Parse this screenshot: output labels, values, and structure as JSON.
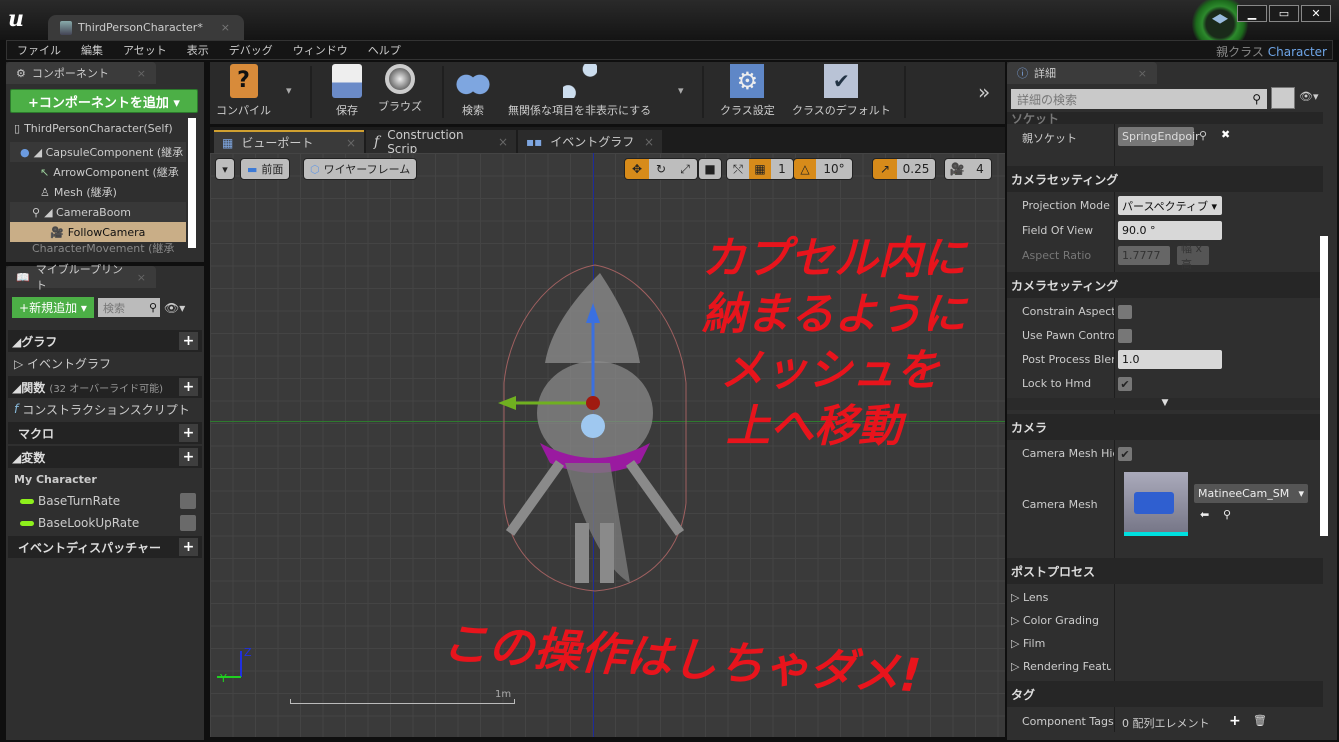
{
  "window": {
    "doc_tab": "ThirdPersonCharacter*",
    "parent_class_label": "親クラス",
    "parent_class_value": "Character",
    "minimize": "▁",
    "maximize": "▭",
    "close": "✕"
  },
  "menu": [
    "ファイル",
    "編集",
    "アセット",
    "表示",
    "デバッグ",
    "ウィンドウ",
    "ヘルプ"
  ],
  "components": {
    "tab": "コンポーネント",
    "add_button": "+コンポーネントを追加 ▾",
    "tree": [
      {
        "label": "ThirdPersonCharacter(Self)",
        "icon": "character-icon"
      },
      {
        "label": "◢ CapsuleComponent (継承",
        "icon": "capsule-icon"
      },
      {
        "label": "ArrowComponent (継承",
        "icon": "arrow-icon"
      },
      {
        "label": "Mesh (継承)",
        "icon": "mesh-icon"
      },
      {
        "label": "◢ CameraBoom",
        "icon": "spring-arm-icon"
      },
      {
        "label": "FollowCamera",
        "icon": "camera-icon"
      },
      {
        "label": "CharacterMovement (継承",
        "icon": "movement-icon"
      }
    ]
  },
  "my_blueprint": {
    "tab": "マイブループリント",
    "new_button": "+新規追加 ▾",
    "search_placeholder": "検索",
    "sections": [
      {
        "title": "◢グラフ",
        "items": [
          "▷ イベントグラフ"
        ]
      },
      {
        "title": "◢関数",
        "subtitle": "(32 オーバーライド可能)",
        "items": [
          "コンストラクションスクリプト"
        ]
      },
      {
        "title": "マクロ",
        "items": []
      },
      {
        "title": "◢変数",
        "items": []
      },
      {
        "title": "イベントディスパッチャー",
        "items": []
      }
    ],
    "var_category": "My Character",
    "variables": [
      "BaseTurnRate",
      "BaseLookUpRate"
    ]
  },
  "toolbar": {
    "compile": "コンパイル",
    "save": "保存",
    "browse": "ブラウズ",
    "find": "検索",
    "hide_unrelated": "無関係な項目を非表示にする",
    "class_settings": "クラス設定",
    "class_defaults": "クラスのデフォルト",
    "more": "»"
  },
  "editor_tabs": [
    "ビューポート",
    "Construction Scrip",
    "イベントグラフ"
  ],
  "viewport": {
    "view_mode_dropdown": "▾",
    "view_front": "前面",
    "view_wireframe": "ワイヤーフレーム",
    "grid_snap": "1",
    "rotation_snap": "10°",
    "scale_snap": "0.25",
    "camera_speed": "4",
    "scale_label": "1m",
    "axis_z": "Z",
    "axis_y": "Y",
    "annotation_1": [
      "カプセル内に",
      "納まるように",
      "メッシュを",
      "上へ移動"
    ],
    "annotation_2": "この操作はしちゃダメ!"
  },
  "details": {
    "tab": "詳細",
    "search_placeholder": "詳細の検索",
    "sections": {
      "socket_header": "ソケット",
      "camera_settings": "カメラセッティング",
      "camera": "カメラ",
      "post_process": "ポストプロセス",
      "tags": "タグ"
    },
    "parent_socket_label": "親ソケット",
    "parent_socket_value": "SpringEndpoir",
    "projection_mode_label": "Projection Mode",
    "projection_mode_value": "パースペクティブ ▾",
    "fov_label": "Field Of View",
    "fov_value": "90.0 °",
    "aspect_label": "Aspect Ratio",
    "aspect_value": "1.7777",
    "aspect_preset": "幅 x 高",
    "constrain_label": "Constrain Aspect R",
    "constrain_checked": false,
    "pawn_control_label": "Use Pawn Control R",
    "pawn_control_checked": false,
    "post_blend_label": "Post Process Blend",
    "post_blend_value": "1.0",
    "lock_hmd_label": "Lock to Hmd",
    "lock_hmd_checked": true,
    "mesh_hidden_label": "Camera Mesh Hidden",
    "mesh_hidden_checked": true,
    "camera_mesh_label": "Camera Mesh",
    "camera_mesh_value": "MatineeCam_SM",
    "pp_items": [
      "Lens",
      "Color Grading",
      "Film",
      "Rendering Features"
    ],
    "component_tags_label": "Component Tags",
    "component_tags_value": "0 配列エレメント"
  }
}
